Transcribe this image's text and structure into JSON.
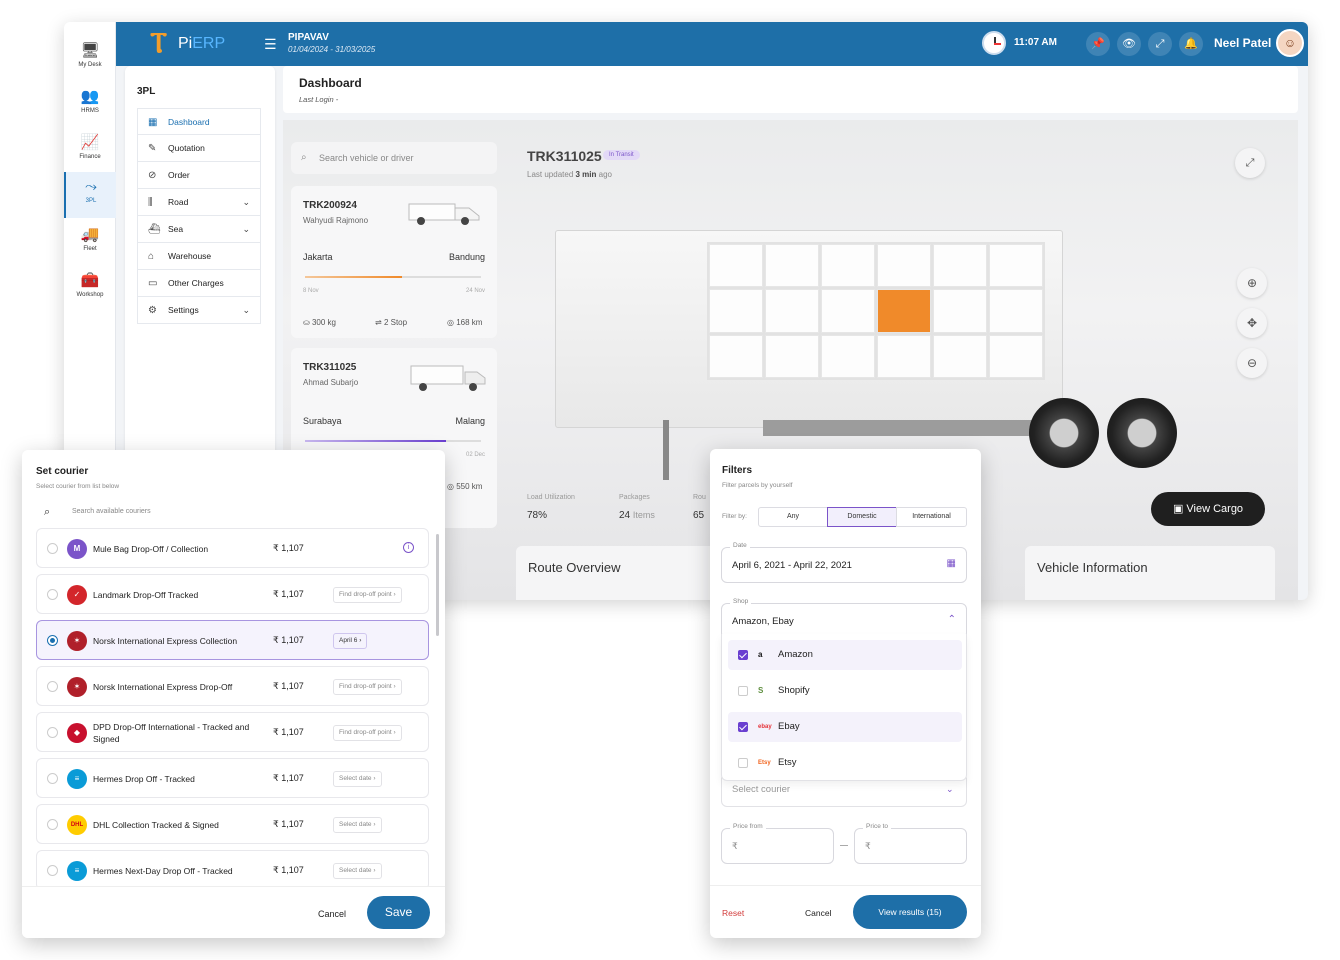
{
  "sidebar_icons": [
    {
      "label": "My Desk",
      "icon": "monitor-icon"
    },
    {
      "label": "HRMS",
      "icon": "people-icon"
    },
    {
      "label": "Finance",
      "icon": "chart-icon"
    },
    {
      "label": "3PL",
      "icon": "route-icon",
      "active": true
    },
    {
      "label": "Fleet",
      "icon": "truck-icon"
    },
    {
      "label": "Workshop",
      "icon": "toolbox-icon"
    }
  ],
  "topbar": {
    "logo_text_a": "Pi",
    "logo_text_b": "ERP",
    "company": "PIPAVAV",
    "period": "01/04/2024 - 31/03/2025",
    "time": "11:07 AM",
    "user": "Neel Patel"
  },
  "menu": {
    "title": "3PL",
    "items": [
      {
        "label": "Dashboard",
        "icon": "grid-icon",
        "active": true
      },
      {
        "label": "Quotation",
        "icon": "quote-icon"
      },
      {
        "label": "Order",
        "icon": "order-icon"
      },
      {
        "label": "Road",
        "icon": "road-icon",
        "expandable": true
      },
      {
        "label": "Sea",
        "icon": "ship-icon",
        "expandable": true
      },
      {
        "label": "Warehouse",
        "icon": "warehouse-icon"
      },
      {
        "label": "Other Charges",
        "icon": "charges-icon"
      },
      {
        "label": "Settings",
        "icon": "settings-icon",
        "expandable": true
      }
    ]
  },
  "dashboard": {
    "title": "Dashboard",
    "last_login": "Last Login -"
  },
  "tracking": {
    "search_placeholder": "Search vehicle or driver",
    "cards": [
      {
        "id": "TRK200924",
        "driver": "Wahyudi Rajmono",
        "from": "Jakarta",
        "to": "Bandung",
        "from_date": "8 Nov",
        "to_date": "24 Nov",
        "weight": "300 kg",
        "stops": "2 Stop",
        "distance": "168 km",
        "progress": 0.55
      },
      {
        "id": "TRK311025",
        "driver": "Ahmad Subarjo",
        "from": "Surabaya",
        "to": "Malang",
        "to_date": "02 Dec",
        "distance": "550 km",
        "progress": 0.8
      }
    ],
    "current": {
      "id": "TRK311025",
      "status": "In Transit",
      "updated_prefix": "Last updated",
      "updated_value": "3 min",
      "updated_suffix": "ago"
    },
    "metrics": [
      {
        "label": "Load Utilization",
        "value": "78%",
        "unit": ""
      },
      {
        "label": "Packages",
        "value": "24",
        "unit": "Items"
      },
      {
        "label": "Rou",
        "value": "65",
        "unit": ""
      }
    ],
    "view_cargo": "View Cargo",
    "route_overview": "Route Overview",
    "vehicle_info": "Vehicle Information",
    "cargo_highlight_index": 9
  },
  "courier_dialog": {
    "title": "Set courier",
    "subtitle": "Select courier from list below",
    "search_placeholder": "Search available couriers",
    "rows": [
      {
        "name": "Mule Bag Drop-Off / Collection",
        "price": "₹ 1,107",
        "action": "",
        "logo_color": "#7b54c9",
        "logo_char": "M"
      },
      {
        "name": "Landmark Drop-Off Tracked",
        "price": "₹ 1,107",
        "action": "Find drop-off point ›",
        "logo_color": "#d3262b",
        "logo_char": "✓"
      },
      {
        "name": "Norsk International Express Collection",
        "price": "₹ 1,107",
        "action": "April 6 ›",
        "logo_color": "#b0202a",
        "logo_char": "✶",
        "selected": true
      },
      {
        "name": "Norsk International Express Drop-Off",
        "price": "₹ 1,107",
        "action": "Find drop-off point ›",
        "logo_color": "#b0202a",
        "logo_char": "✶"
      },
      {
        "name": "DPD Drop-Off International - Tracked and Signed",
        "price": "₹ 1,107",
        "action": "Find drop-off point ›",
        "logo_color": "#c8102e",
        "logo_char": "◆"
      },
      {
        "name": "Hermes Drop Off - Tracked",
        "price": "₹ 1,107",
        "action": "Select date ›",
        "logo_color": "#0a9bd7",
        "logo_char": "≡"
      },
      {
        "name": "DHL Collection Tracked & Signed",
        "price": "₹ 1,107",
        "action": "Select date ›",
        "logo_color": "#ffcc00",
        "logo_char": "DHL"
      },
      {
        "name": "Hermes Next-Day Drop Off - Tracked",
        "price": "₹ 1,107",
        "action": "Select date ›",
        "logo_color": "#0a9bd7",
        "logo_char": "≡"
      }
    ],
    "cancel": "Cancel",
    "save": "Save"
  },
  "filters_dialog": {
    "title": "Filters",
    "subtitle": "Filter parcels by yourself",
    "filter_by": "Filter by:",
    "segments": [
      "Any",
      "Domestic",
      "International"
    ],
    "active_segment": "Domestic",
    "date_label": "Date",
    "date_value": "April 6, 2021 - April 22, 2021",
    "shop_label": "Shop",
    "shop_value": "Amazon, Ebay",
    "shops": [
      {
        "name": "Amazon",
        "checked": true,
        "logo": "a",
        "logo_color": "#111111"
      },
      {
        "name": "Shopify",
        "checked": false,
        "logo": "S",
        "logo_color": "#5e8e3e"
      },
      {
        "name": "Ebay",
        "checked": true,
        "logo": "ebay",
        "logo_color": "#e53238"
      },
      {
        "name": "Etsy",
        "checked": false,
        "logo": "Etsy",
        "logo_color": "#f1641e"
      }
    ],
    "courier_placeholder": "Select courier",
    "price_from_label": "Price from",
    "price_to_label": "Price to",
    "currency": "₹",
    "reset": "Reset",
    "cancel": "Cancel",
    "view_results": "View results (15)"
  }
}
